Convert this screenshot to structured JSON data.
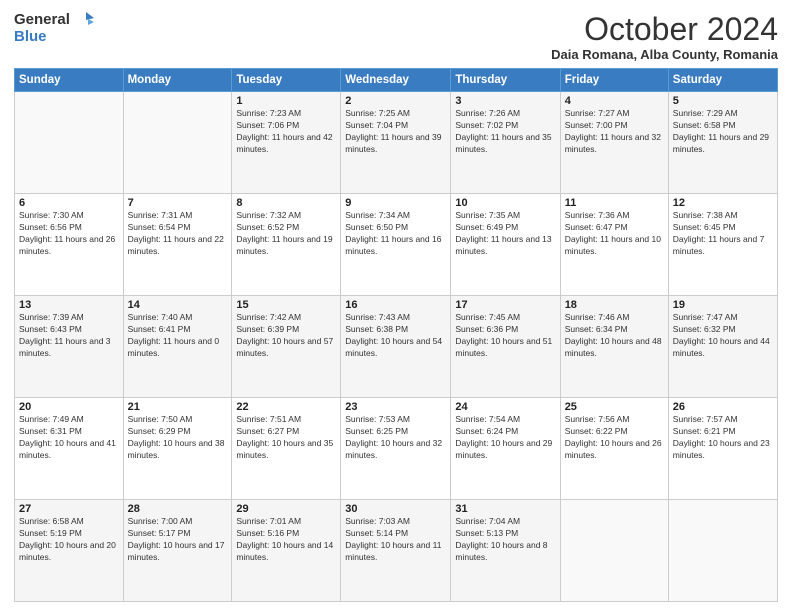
{
  "header": {
    "logo_general": "General",
    "logo_blue": "Blue",
    "month_title": "October 2024",
    "location": "Daia Romana, Alba County, Romania"
  },
  "days_of_week": [
    "Sunday",
    "Monday",
    "Tuesday",
    "Wednesday",
    "Thursday",
    "Friday",
    "Saturday"
  ],
  "weeks": [
    [
      {
        "day": "",
        "info": ""
      },
      {
        "day": "",
        "info": ""
      },
      {
        "day": "1",
        "info": "Sunrise: 7:23 AM\nSunset: 7:06 PM\nDaylight: 11 hours and 42 minutes."
      },
      {
        "day": "2",
        "info": "Sunrise: 7:25 AM\nSunset: 7:04 PM\nDaylight: 11 hours and 39 minutes."
      },
      {
        "day": "3",
        "info": "Sunrise: 7:26 AM\nSunset: 7:02 PM\nDaylight: 11 hours and 35 minutes."
      },
      {
        "day": "4",
        "info": "Sunrise: 7:27 AM\nSunset: 7:00 PM\nDaylight: 11 hours and 32 minutes."
      },
      {
        "day": "5",
        "info": "Sunrise: 7:29 AM\nSunset: 6:58 PM\nDaylight: 11 hours and 29 minutes."
      }
    ],
    [
      {
        "day": "6",
        "info": "Sunrise: 7:30 AM\nSunset: 6:56 PM\nDaylight: 11 hours and 26 minutes."
      },
      {
        "day": "7",
        "info": "Sunrise: 7:31 AM\nSunset: 6:54 PM\nDaylight: 11 hours and 22 minutes."
      },
      {
        "day": "8",
        "info": "Sunrise: 7:32 AM\nSunset: 6:52 PM\nDaylight: 11 hours and 19 minutes."
      },
      {
        "day": "9",
        "info": "Sunrise: 7:34 AM\nSunset: 6:50 PM\nDaylight: 11 hours and 16 minutes."
      },
      {
        "day": "10",
        "info": "Sunrise: 7:35 AM\nSunset: 6:49 PM\nDaylight: 11 hours and 13 minutes."
      },
      {
        "day": "11",
        "info": "Sunrise: 7:36 AM\nSunset: 6:47 PM\nDaylight: 11 hours and 10 minutes."
      },
      {
        "day": "12",
        "info": "Sunrise: 7:38 AM\nSunset: 6:45 PM\nDaylight: 11 hours and 7 minutes."
      }
    ],
    [
      {
        "day": "13",
        "info": "Sunrise: 7:39 AM\nSunset: 6:43 PM\nDaylight: 11 hours and 3 minutes."
      },
      {
        "day": "14",
        "info": "Sunrise: 7:40 AM\nSunset: 6:41 PM\nDaylight: 11 hours and 0 minutes."
      },
      {
        "day": "15",
        "info": "Sunrise: 7:42 AM\nSunset: 6:39 PM\nDaylight: 10 hours and 57 minutes."
      },
      {
        "day": "16",
        "info": "Sunrise: 7:43 AM\nSunset: 6:38 PM\nDaylight: 10 hours and 54 minutes."
      },
      {
        "day": "17",
        "info": "Sunrise: 7:45 AM\nSunset: 6:36 PM\nDaylight: 10 hours and 51 minutes."
      },
      {
        "day": "18",
        "info": "Sunrise: 7:46 AM\nSunset: 6:34 PM\nDaylight: 10 hours and 48 minutes."
      },
      {
        "day": "19",
        "info": "Sunrise: 7:47 AM\nSunset: 6:32 PM\nDaylight: 10 hours and 44 minutes."
      }
    ],
    [
      {
        "day": "20",
        "info": "Sunrise: 7:49 AM\nSunset: 6:31 PM\nDaylight: 10 hours and 41 minutes."
      },
      {
        "day": "21",
        "info": "Sunrise: 7:50 AM\nSunset: 6:29 PM\nDaylight: 10 hours and 38 minutes."
      },
      {
        "day": "22",
        "info": "Sunrise: 7:51 AM\nSunset: 6:27 PM\nDaylight: 10 hours and 35 minutes."
      },
      {
        "day": "23",
        "info": "Sunrise: 7:53 AM\nSunset: 6:25 PM\nDaylight: 10 hours and 32 minutes."
      },
      {
        "day": "24",
        "info": "Sunrise: 7:54 AM\nSunset: 6:24 PM\nDaylight: 10 hours and 29 minutes."
      },
      {
        "day": "25",
        "info": "Sunrise: 7:56 AM\nSunset: 6:22 PM\nDaylight: 10 hours and 26 minutes."
      },
      {
        "day": "26",
        "info": "Sunrise: 7:57 AM\nSunset: 6:21 PM\nDaylight: 10 hours and 23 minutes."
      }
    ],
    [
      {
        "day": "27",
        "info": "Sunrise: 6:58 AM\nSunset: 5:19 PM\nDaylight: 10 hours and 20 minutes."
      },
      {
        "day": "28",
        "info": "Sunrise: 7:00 AM\nSunset: 5:17 PM\nDaylight: 10 hours and 17 minutes."
      },
      {
        "day": "29",
        "info": "Sunrise: 7:01 AM\nSunset: 5:16 PM\nDaylight: 10 hours and 14 minutes."
      },
      {
        "day": "30",
        "info": "Sunrise: 7:03 AM\nSunset: 5:14 PM\nDaylight: 10 hours and 11 minutes."
      },
      {
        "day": "31",
        "info": "Sunrise: 7:04 AM\nSunset: 5:13 PM\nDaylight: 10 hours and 8 minutes."
      },
      {
        "day": "",
        "info": ""
      },
      {
        "day": "",
        "info": ""
      }
    ]
  ]
}
